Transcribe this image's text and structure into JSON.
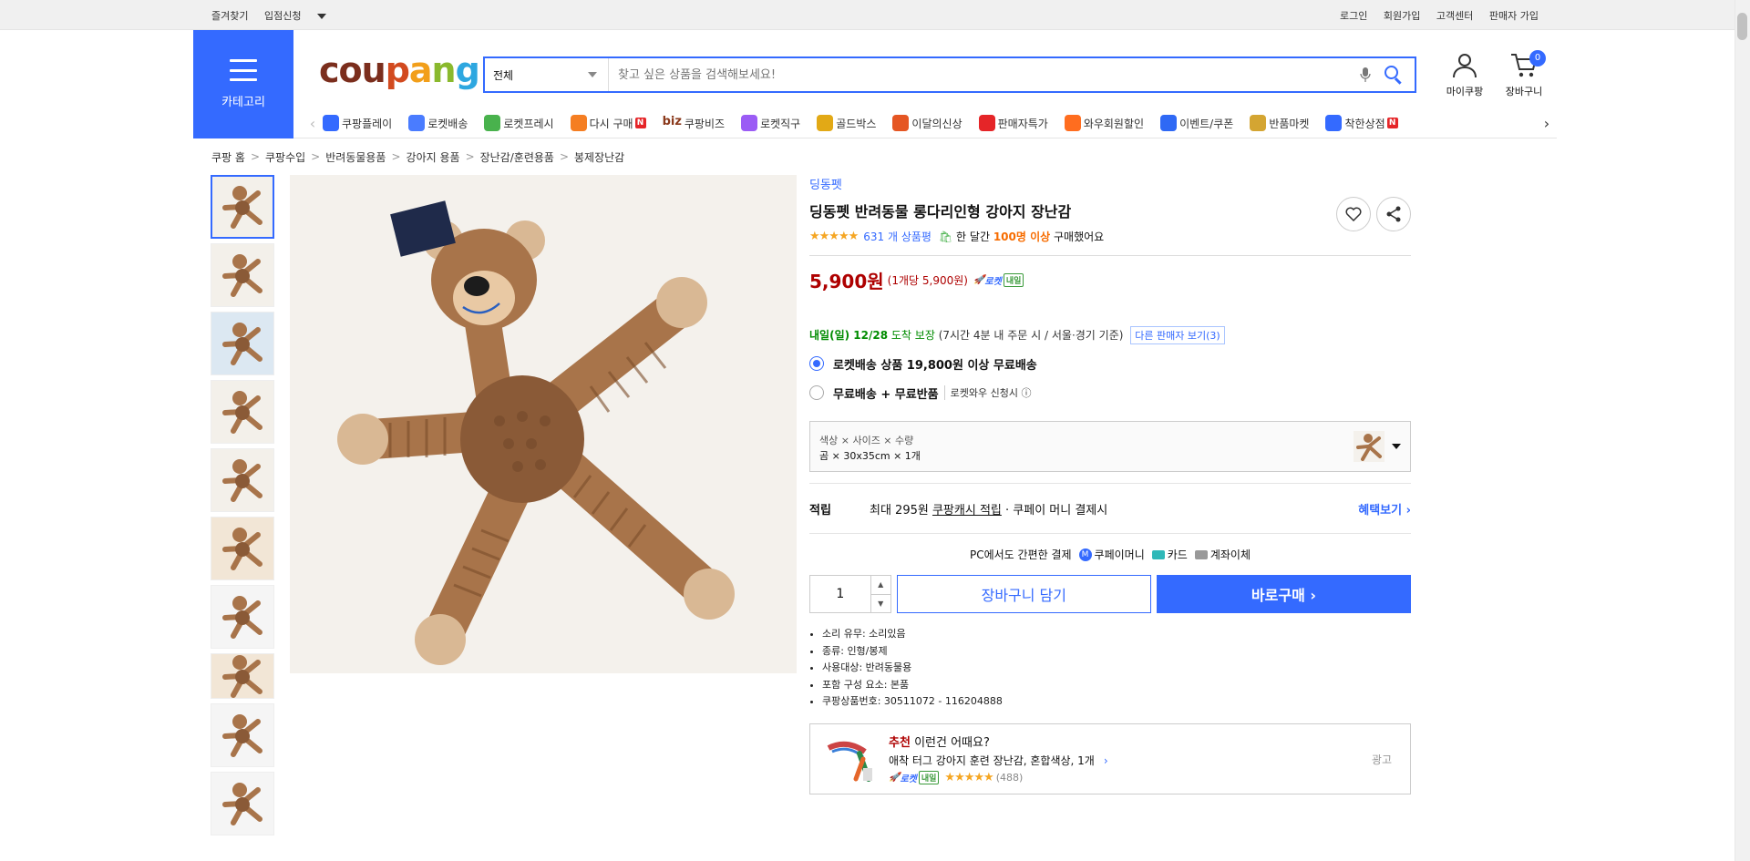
{
  "topbar": {
    "favorites": "즐겨찾기",
    "seller_apply": "입점신청",
    "login": "로그인",
    "signup": "회원가입",
    "cs": "고객센터",
    "seller_join": "판매자 가입"
  },
  "header": {
    "category_label": "카테고리",
    "logo": [
      "cou",
      "p",
      "a",
      "n",
      "g"
    ],
    "search_scope": "전체",
    "search_placeholder": "찾고 싶은 상품을 검색해보세요!",
    "mycoupang": "마이쿠팡",
    "cart": "장바구니",
    "cart_count": "0"
  },
  "nav": [
    {
      "label": "쿠팡플레이",
      "color": "#346aff",
      "new": false
    },
    {
      "label": "로켓배송",
      "color": "#4a7cff",
      "new": false
    },
    {
      "label": "로켓프레시",
      "color": "#49b24d",
      "new": false
    },
    {
      "label": "다시 구매",
      "color": "#f57e22",
      "new": true
    },
    {
      "label": "쿠팡비즈",
      "color": "#8b3a1c",
      "new": false,
      "prefix": "biz"
    },
    {
      "label": "로켓직구",
      "color": "#9b5cf5",
      "new": false
    },
    {
      "label": "골드박스",
      "color": "#e2a916",
      "new": false
    },
    {
      "label": "이달의신상",
      "color": "#e55623",
      "new": false
    },
    {
      "label": "판매자특가",
      "color": "#e52528",
      "new": false
    },
    {
      "label": "와우회원할인",
      "color": "#ff6d1f",
      "new": false
    },
    {
      "label": "이벤트/쿠폰",
      "color": "#2f69f5",
      "new": false
    },
    {
      "label": "반품마켓",
      "color": "#d4a532",
      "new": false
    },
    {
      "label": "착한상점",
      "color": "#346aff",
      "new": true
    }
  ],
  "breadcrumb": [
    "쿠팡 홈",
    "쿠팡수입",
    "반려동물용품",
    "강아지 용품",
    "장난감/훈련용품",
    "봉제장난감"
  ],
  "product": {
    "brand": "딩동펫",
    "title": "딩동펫 반려동물 롱다리인형 강아지 장난감",
    "stars": "★★★★★",
    "rating": 4.5,
    "review_count": "631 개 상품평",
    "buy_prefix": "한 달간",
    "buy_count": "100명 이상",
    "buy_suffix": "구매했어요",
    "price": "5,900원",
    "unit_price": "(1개당 5,900원)",
    "rocket_label": "로켓",
    "rocket_tag": "내일",
    "delivery_date": "내일(일) 12/28",
    "delivery_guarantee": "도착 보장",
    "delivery_note": "(7시간 4분 내 주문 시 / 서울⋅경기 기준)",
    "other_sellers": "다른 판매자 보기(3)",
    "option1": "로켓배송 상품 19,800원 이상 무료배송",
    "option2": "무료배송 + 무료반품",
    "option2_sub": "로켓와우 신청시 ⓘ",
    "option_header": "색상 × 사이즈 × 수량",
    "option_value": "곰 × 30x35cm × 1개",
    "reward_label": "적립",
    "reward_prefix": "최대 295원",
    "reward_link": "쿠팡캐시 적립",
    "reward_suffix": "· 쿠페이 머니 결제시",
    "reward_more": "혜택보기 ›",
    "pay_title": "PC에서도 간편한 결제",
    "pay_money": "쿠페이머니",
    "pay_card": "카드",
    "pay_bank": "계좌이체",
    "quantity": "1",
    "cart_button": "장바구니 담기",
    "buy_button": "바로구매 ›",
    "specs": [
      "소리 유무: 소리있음",
      "종류: 인형/봉제",
      "사용대상: 반려동물용",
      "포함 구성 요소: 본품",
      "쿠팡상품번호: 30511072 - 116204888"
    ]
  },
  "reco": {
    "badge": "추천",
    "title": "이런건 어때요?",
    "name": "애착 터그 강아지 훈련 장난감, 혼합색상, 1개",
    "rocket": "로켓",
    "tag": "내일",
    "stars": "★★★★★",
    "count": "(488)",
    "ad": "광고"
  },
  "colors": {
    "accent": "#346aff",
    "price": "#ae0000",
    "green": "#008c00"
  }
}
